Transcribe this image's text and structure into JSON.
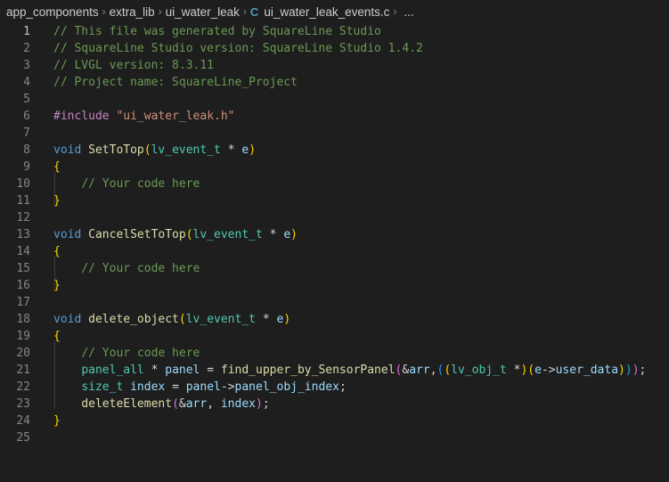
{
  "breadcrumb": {
    "items": [
      "app_components",
      "extra_lib",
      "ui_water_leak",
      "ui_water_leak_events.c"
    ],
    "file_icon": "C",
    "ellipsis": "..."
  },
  "editor": {
    "active_line": 1,
    "lines": [
      [
        [
          "// This file was generated by SquareLine Studio",
          "comment"
        ]
      ],
      [
        [
          "// SquareLine Studio version: SquareLine Studio 1.4.2",
          "comment"
        ]
      ],
      [
        [
          "// LVGL version: 8.3.11",
          "comment"
        ]
      ],
      [
        [
          "// Project name: SquareLine_Project",
          "comment"
        ]
      ],
      [],
      [
        [
          "#include ",
          "preproc"
        ],
        [
          "\"ui_water_leak.h\"",
          "string"
        ]
      ],
      [],
      [
        [
          "void ",
          "keyword"
        ],
        [
          "SetToTop",
          "func"
        ],
        [
          "(",
          "brace"
        ],
        [
          "lv_event_t",
          "type"
        ],
        [
          " * ",
          "plain"
        ],
        [
          "e",
          "var"
        ],
        [
          ")",
          "brace"
        ]
      ],
      [
        [
          "{",
          "brace"
        ]
      ],
      [
        [
          "    ",
          "plain"
        ],
        [
          "// Your code here",
          "comment"
        ]
      ],
      [
        [
          "}",
          "brace"
        ]
      ],
      [],
      [
        [
          "void ",
          "keyword"
        ],
        [
          "CancelSetToTop",
          "func"
        ],
        [
          "(",
          "brace"
        ],
        [
          "lv_event_t",
          "type"
        ],
        [
          " * ",
          "plain"
        ],
        [
          "e",
          "var"
        ],
        [
          ")",
          "brace"
        ]
      ],
      [
        [
          "{",
          "brace"
        ]
      ],
      [
        [
          "    ",
          "plain"
        ],
        [
          "// Your code here",
          "comment"
        ]
      ],
      [
        [
          "}",
          "brace"
        ]
      ],
      [],
      [
        [
          "void ",
          "keyword"
        ],
        [
          "delete_object",
          "func"
        ],
        [
          "(",
          "brace"
        ],
        [
          "lv_event_t",
          "type"
        ],
        [
          " * ",
          "plain"
        ],
        [
          "e",
          "var"
        ],
        [
          ")",
          "brace"
        ]
      ],
      [
        [
          "{",
          "brace"
        ]
      ],
      [
        [
          "    ",
          "plain"
        ],
        [
          "// Your code here",
          "comment"
        ]
      ],
      [
        [
          "    ",
          "plain"
        ],
        [
          "panel_all",
          "type"
        ],
        [
          " * ",
          "plain"
        ],
        [
          "panel",
          "var"
        ],
        [
          " = ",
          "plain"
        ],
        [
          "find_upper_by_SensorPanel",
          "func"
        ],
        [
          "(",
          "paren2"
        ],
        [
          "&",
          "plain"
        ],
        [
          "arr",
          "var"
        ],
        [
          ",",
          "plain"
        ],
        [
          "(",
          "paren3"
        ],
        [
          "(",
          "brace"
        ],
        [
          "lv_obj_t",
          "type"
        ],
        [
          " *",
          "plain"
        ],
        [
          ")",
          "brace"
        ],
        [
          "(",
          "brace"
        ],
        [
          "e",
          "var"
        ],
        [
          "->",
          "plain"
        ],
        [
          "user_data",
          "var"
        ],
        [
          ")",
          "brace"
        ],
        [
          ")",
          "paren3"
        ],
        [
          ")",
          "paren2"
        ],
        [
          ";",
          "plain"
        ]
      ],
      [
        [
          "    ",
          "plain"
        ],
        [
          "size_t",
          "type"
        ],
        [
          " ",
          "plain"
        ],
        [
          "index",
          "var"
        ],
        [
          " = ",
          "plain"
        ],
        [
          "panel",
          "var"
        ],
        [
          "->",
          "plain"
        ],
        [
          "panel_obj_index",
          "var"
        ],
        [
          ";",
          "plain"
        ]
      ],
      [
        [
          "    ",
          "plain"
        ],
        [
          "deleteElement",
          "func"
        ],
        [
          "(",
          "paren2"
        ],
        [
          "&",
          "plain"
        ],
        [
          "arr",
          "var"
        ],
        [
          ", ",
          "plain"
        ],
        [
          "index",
          "var"
        ],
        [
          ")",
          "paren2"
        ],
        [
          ";",
          "plain"
        ]
      ],
      [
        [
          "}",
          "brace"
        ]
      ],
      []
    ]
  }
}
